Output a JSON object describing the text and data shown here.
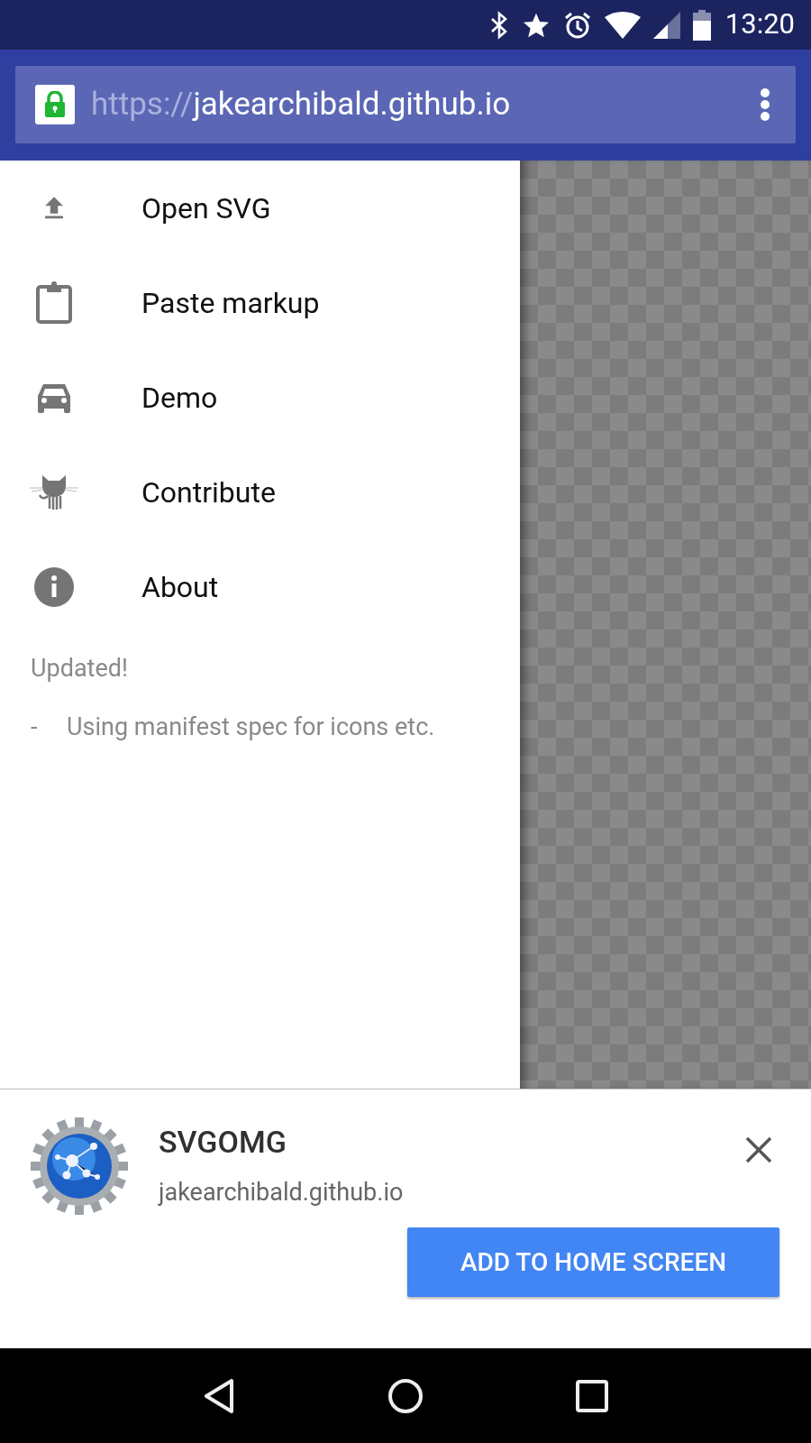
{
  "status_bar": {
    "time": "13:20"
  },
  "address_bar": {
    "scheme": "https://",
    "host": "jakearchibald.github.io"
  },
  "menu": [
    {
      "label": "Open SVG"
    },
    {
      "label": "Paste markup"
    },
    {
      "label": "Demo"
    },
    {
      "label": "Contribute"
    },
    {
      "label": "About"
    }
  ],
  "changelog": {
    "heading": "Updated!",
    "items": [
      {
        "bullet": "-",
        "text": "Using manifest spec for icons etc."
      }
    ]
  },
  "install_banner": {
    "title": "SVGOMG",
    "subtitle": "jakearchibald.github.io",
    "button": "ADD TO HOME SCREEN"
  }
}
